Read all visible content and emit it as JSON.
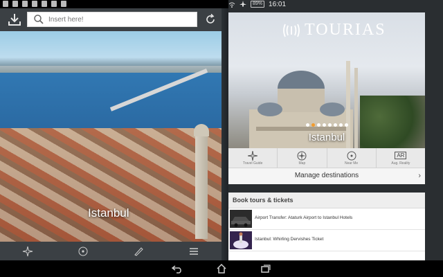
{
  "status_bar": {
    "battery": "89%",
    "time": "16:01"
  },
  "search": {
    "placeholder": "Insert here!"
  },
  "left_panel": {
    "city_label": "Istanbul"
  },
  "right_panel": {
    "brand": "TOURIAS",
    "hero_title": "Istanbul",
    "carousel_total": 8,
    "carousel_active": 1,
    "features": [
      {
        "label": "Travel Guide",
        "icon": "compass-star-icon"
      },
      {
        "label": "Map",
        "icon": "compass-rose-icon"
      },
      {
        "label": "Near Me",
        "icon": "target-icon"
      },
      {
        "label": "Aug. Reality",
        "icon": "ar-icon",
        "glyph": "AR"
      }
    ],
    "manage_label": "Manage destinations",
    "tours_header": "Book tours & tickets",
    "tours": [
      {
        "title": "Airport Transfer: Ataturk Airport to Istanbul Hotels"
      },
      {
        "title": "Istanbul: Whirling Dervishes Ticket"
      }
    ]
  },
  "colors": {
    "accent": "#f29b2d",
    "toolbar": "#3b4044"
  }
}
